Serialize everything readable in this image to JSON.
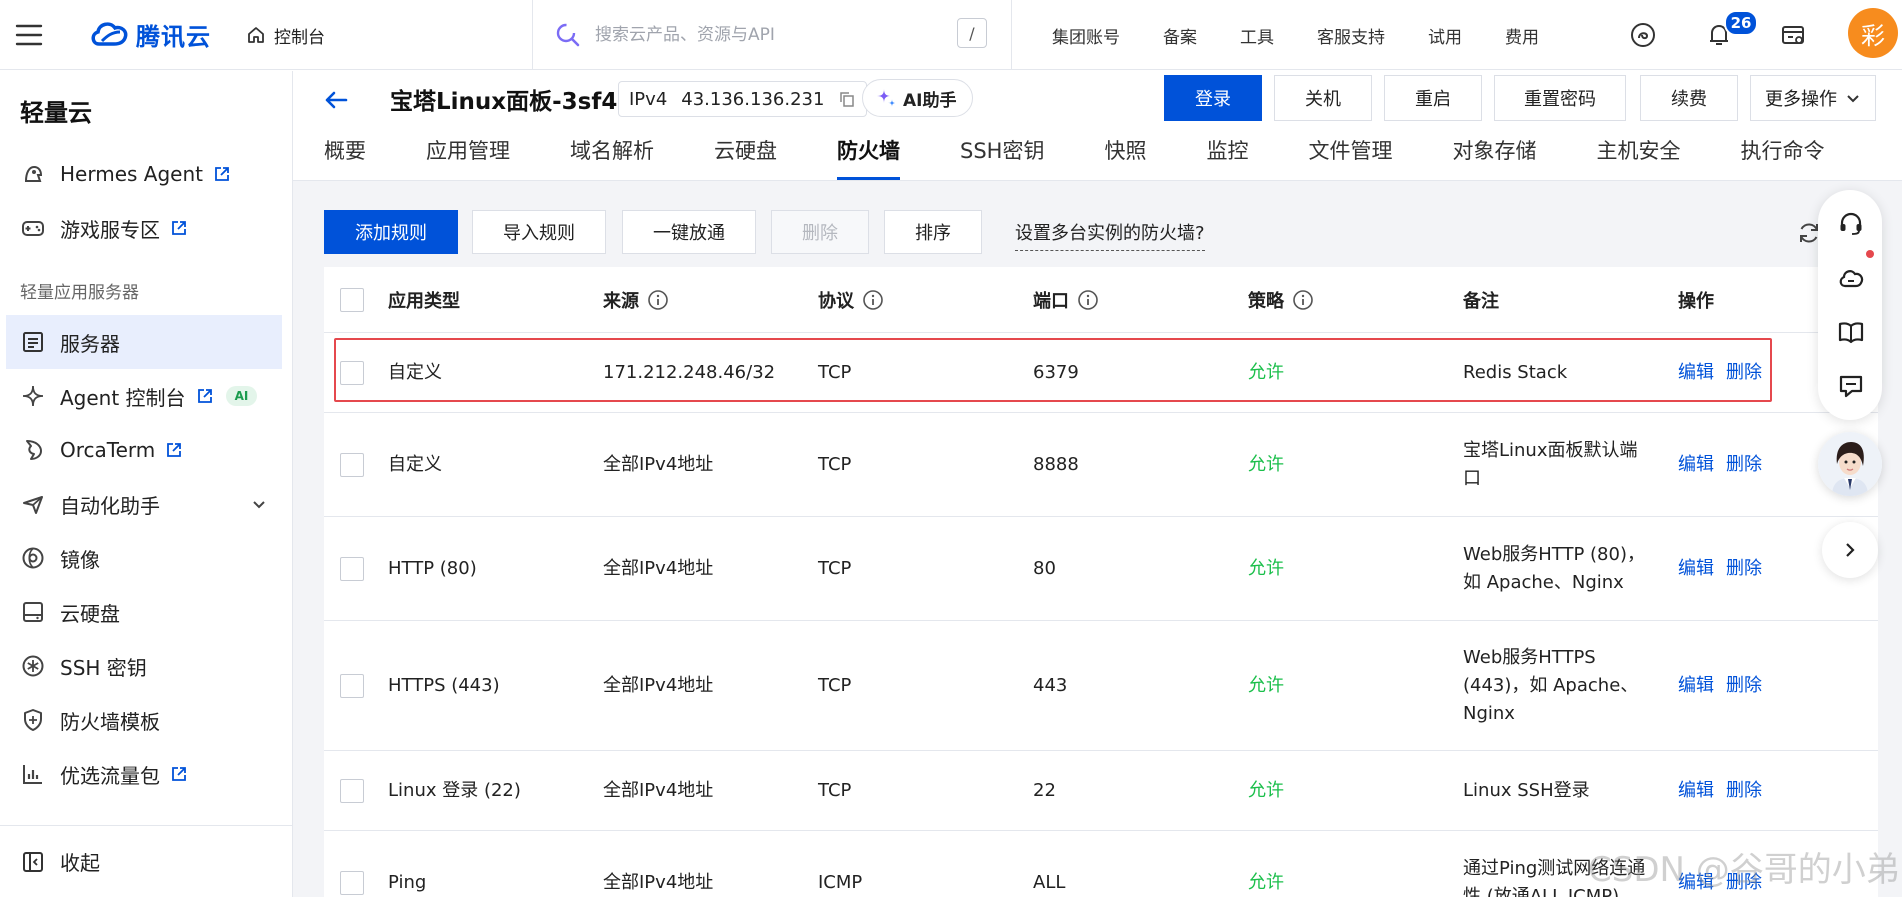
{
  "topbar": {
    "logo_text": "腾讯云",
    "console_label": "控制台",
    "search_placeholder": "搜索云产品、资源与API",
    "search_shortcut": "/",
    "nav": [
      "集团账号",
      "备案",
      "工具",
      "客服支持",
      "试用",
      "费用"
    ],
    "notification_count": "26",
    "avatar_text": "彩"
  },
  "sidebar": {
    "title": "轻量云",
    "items_top": [
      {
        "label": "Hermes Agent",
        "icon": "hermes-icon",
        "external": true
      },
      {
        "label": "游戏服专区",
        "icon": "gamepad-icon",
        "external": true
      }
    ],
    "section_label": "轻量应用服务器",
    "items": [
      {
        "label": "服务器",
        "icon": "server-list-icon",
        "active": true
      },
      {
        "label": "Agent 控制台",
        "icon": "sparkle-icon",
        "external": true,
        "badge": "AI"
      },
      {
        "label": "OrcaTerm",
        "icon": "orca-icon",
        "external": true
      },
      {
        "label": "自动化助手",
        "icon": "automation-icon",
        "expandable": true
      },
      {
        "label": "镜像",
        "icon": "image-disc-icon"
      },
      {
        "label": "云硬盘",
        "icon": "disk-icon"
      },
      {
        "label": "SSH 密钥",
        "icon": "ssh-key-icon"
      },
      {
        "label": "防火墙模板",
        "icon": "shield-icon"
      },
      {
        "label": "优选流量包",
        "icon": "traffic-icon",
        "external": true
      }
    ],
    "footer_label": "收起"
  },
  "instance": {
    "name": "宝塔Linux面板-3sf4",
    "ip_type": "IPv4",
    "ip": "43.136.136.231",
    "ai_button": "AI助手",
    "actions": [
      "登录",
      "关机",
      "重启",
      "重置密码",
      "续费",
      "更多操作"
    ]
  },
  "tabs": [
    "概要",
    "应用管理",
    "域名解析",
    "云硬盘",
    "防火墙",
    "SSH密钥",
    "快照",
    "监控",
    "文件管理",
    "对象存储",
    "主机安全",
    "执行命令"
  ],
  "active_tab": "防火墙",
  "toolbar": {
    "add_rule": "添加规则",
    "import_rule": "导入规则",
    "open_all": "一键放通",
    "delete": "删除",
    "sort": "排序",
    "multi_link": "设置多台实例的防火墙?"
  },
  "table": {
    "headers": [
      "应用类型",
      "来源",
      "协议",
      "端口",
      "策略",
      "备注",
      "操作"
    ],
    "edit_label": "编辑",
    "delete_label": "删除",
    "rows": [
      {
        "type": "自定义",
        "source": "171.212.248.46/32",
        "protocol": "TCP",
        "port": "6379",
        "policy": "允许",
        "note": "Redis Stack"
      },
      {
        "type": "自定义",
        "source": "全部IPv4地址",
        "protocol": "TCP",
        "port": "8888",
        "policy": "允许",
        "note": "宝塔Linux面板默认端口"
      },
      {
        "type": "HTTP (80)",
        "source": "全部IPv4地址",
        "protocol": "TCP",
        "port": "80",
        "policy": "允许",
        "note": "Web服务HTTP (80)，如 Apache、Nginx"
      },
      {
        "type": "HTTPS (443)",
        "source": "全部IPv4地址",
        "protocol": "TCP",
        "port": "443",
        "policy": "允许",
        "note": "Web服务HTTPS (443)，如 Apache、Nginx"
      },
      {
        "type": "Linux 登录 (22)",
        "source": "全部IPv4地址",
        "protocol": "TCP",
        "port": "22",
        "policy": "允许",
        "note": "Linux SSH登录"
      },
      {
        "type": "Ping",
        "source": "全部IPv4地址",
        "protocol": "ICMP",
        "port": "ALL",
        "policy": "允许",
        "note": "通过Ping测试网络连通性 (放通ALL ICMP)"
      }
    ]
  },
  "watermark": "CSDN @谷哥的小弟",
  "colors": {
    "primary": "#0052d9",
    "allow": "#1bbf4b",
    "highlight": "#e5484d"
  }
}
